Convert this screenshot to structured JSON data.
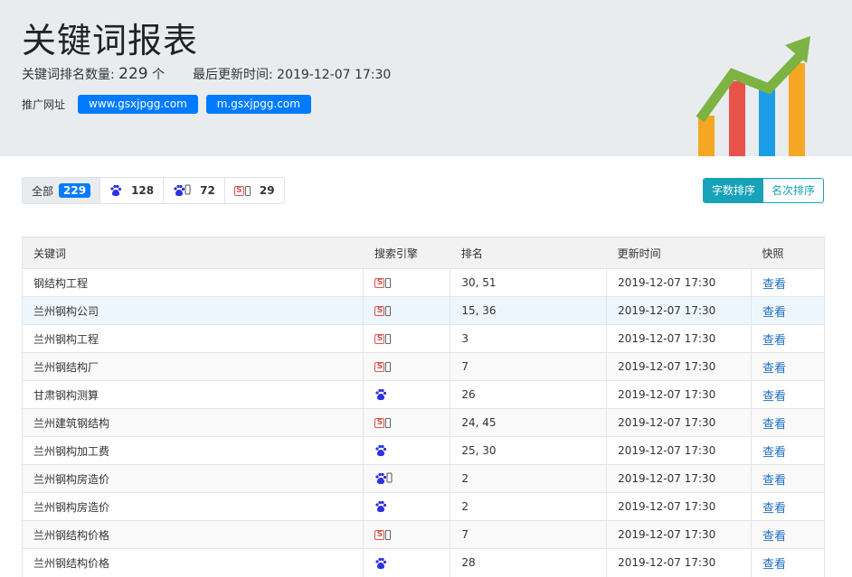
{
  "header": {
    "title": "关键词报表",
    "count_label": "关键词排名数量:",
    "count_value": "229",
    "count_unit": "个",
    "update_label": "最后更新时间:",
    "update_value": "2019-12-07 17:30",
    "promo_label": "推广网址",
    "urls": [
      "www.gsxjpgg.com",
      "m.gsxjpgg.com"
    ]
  },
  "filters": [
    {
      "label": "全部",
      "count": "229",
      "icon": "all"
    },
    {
      "label": "",
      "count": "128",
      "icon": "baidu-icon"
    },
    {
      "label": "",
      "count": "72",
      "icon": "baidu-mobile-icon"
    },
    {
      "label": "",
      "count": "29",
      "icon": "so-mobile-icon"
    }
  ],
  "sort": [
    "字数排序",
    "名次排序"
  ],
  "table": {
    "headers": [
      "关键词",
      "搜索引擎",
      "排名",
      "更新时间",
      "快照"
    ],
    "rows": [
      {
        "keyword": "钢结构工程",
        "engine": "so-mobile",
        "rank": "30, 51",
        "time": "2019-12-07 17:30",
        "link": "查看"
      },
      {
        "keyword": "兰州钢构公司",
        "engine": "so-mobile",
        "rank": "15, 36",
        "time": "2019-12-07 17:30",
        "link": "查看"
      },
      {
        "keyword": "兰州钢构工程",
        "engine": "so-mobile",
        "rank": "3",
        "time": "2019-12-07 17:30",
        "link": "查看"
      },
      {
        "keyword": "兰州钢结构厂",
        "engine": "so-mobile",
        "rank": "7",
        "time": "2019-12-07 17:30",
        "link": "查看"
      },
      {
        "keyword": "甘肃钢构测算",
        "engine": "baidu",
        "rank": "26",
        "time": "2019-12-07 17:30",
        "link": "查看"
      },
      {
        "keyword": "兰州建筑钢结构",
        "engine": "so-mobile",
        "rank": "24, 45",
        "time": "2019-12-07 17:30",
        "link": "查看"
      },
      {
        "keyword": "兰州钢构加工费",
        "engine": "baidu",
        "rank": "25, 30",
        "time": "2019-12-07 17:30",
        "link": "查看"
      },
      {
        "keyword": "兰州钢构房造价",
        "engine": "baidu-mobile",
        "rank": "2",
        "time": "2019-12-07 17:30",
        "link": "查看"
      },
      {
        "keyword": "兰州钢构房造价",
        "engine": "baidu",
        "rank": "2",
        "time": "2019-12-07 17:30",
        "link": "查看"
      },
      {
        "keyword": "兰州钢结构价格",
        "engine": "so-mobile",
        "rank": "7",
        "time": "2019-12-07 17:30",
        "link": "查看"
      },
      {
        "keyword": "兰州钢结构价格",
        "engine": "baidu",
        "rank": "28",
        "time": "2019-12-07 17:30",
        "link": "查看"
      }
    ]
  },
  "colors": {
    "accent": "#007bff",
    "sort_accent": "#17a2b8",
    "link": "#1d6fc7",
    "header_bg": "#e9ecef",
    "chart_bars": [
      "#f5a623",
      "#e8524a",
      "#1b9ee6",
      "#f5a623"
    ],
    "chart_arrow": "#7cb342"
  }
}
